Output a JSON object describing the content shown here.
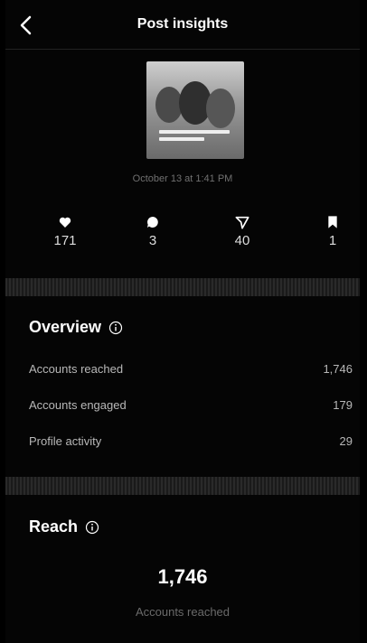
{
  "header": {
    "title": "Post insights",
    "back_icon": "chevron-left-icon"
  },
  "post": {
    "date": "October 13 at 1:41 PM"
  },
  "stats": [
    {
      "icon": "heart-icon",
      "value": "171"
    },
    {
      "icon": "comment-icon",
      "value": "3"
    },
    {
      "icon": "share-icon",
      "value": "40"
    },
    {
      "icon": "bookmark-icon",
      "value": "1"
    }
  ],
  "overview": {
    "title": "Overview",
    "rows": [
      {
        "label": "Accounts reached",
        "value": "1,746"
      },
      {
        "label": "Accounts engaged",
        "value": "179"
      },
      {
        "label": "Profile activity",
        "value": "29"
      }
    ]
  },
  "reach": {
    "title": "Reach",
    "value": "1,746",
    "caption": "Accounts reached"
  }
}
